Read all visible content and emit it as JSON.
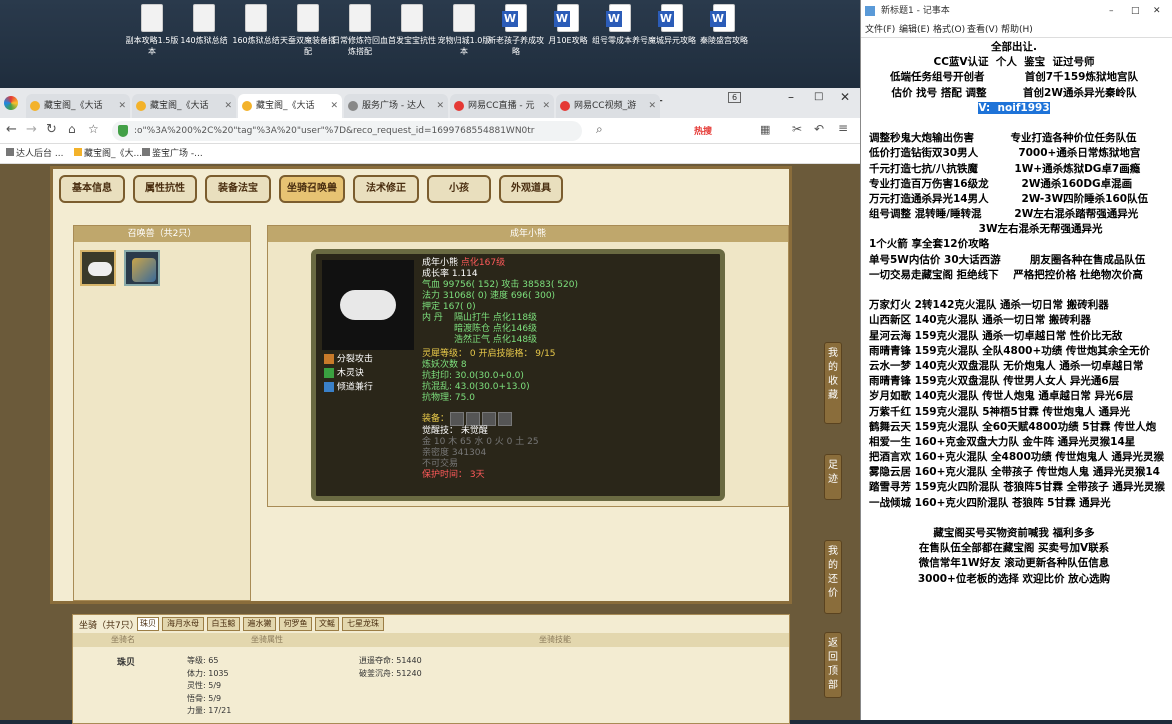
{
  "desktop": {
    "icons": [
      {
        "label": "副本攻略1.5版本",
        "type": "doc"
      },
      {
        "label": "140炼狱总结",
        "type": "doc"
      },
      {
        "label": "160炼狱总结",
        "type": "doc"
      },
      {
        "label": "天蚕双魔装备搭配",
        "type": "doc"
      },
      {
        "label": "日常修炼符回血炼搭配",
        "type": "doc"
      },
      {
        "label": "首发宝宝抗性",
        "type": "doc"
      },
      {
        "label": "宠物归城1.0版本",
        "type": "doc"
      },
      {
        "label": "新老孩子养成攻略",
        "type": "word"
      },
      {
        "label": "月10E攻略",
        "type": "word"
      },
      {
        "label": "组号零成本养号",
        "type": "word"
      },
      {
        "label": "魔城异元攻略",
        "type": "word"
      },
      {
        "label": "秦陵盛宫攻略",
        "type": "word"
      }
    ]
  },
  "browser": {
    "tabs": [
      {
        "label": "藏宝阁_《大话"
      },
      {
        "label": "藏宝阁_《大话"
      },
      {
        "label": "藏宝阁_《大话",
        "active": true
      },
      {
        "label": "服务广场 - 达人"
      },
      {
        "label": "网易CC直播 - 元"
      },
      {
        "label": "网易CC视频_游"
      }
    ],
    "tab_counter": "6",
    "address": ":o\"%3A%200%2C%20\"tag\"%3A%20\"user\"%7D&reco_request_id=1699768554881WN0tr",
    "hot_label": "热搜",
    "bookmarks": [
      "达人后台 ...",
      "藏宝阁_《大...",
      "鉴宝广场 -..."
    ]
  },
  "game": {
    "tabs": [
      "基本信息",
      "属性抗性",
      "装备法宝",
      "坐骑召唤兽",
      "法术修正",
      "小孩",
      "外观道具"
    ],
    "active_tab": "坐骑召唤兽",
    "summon_header": "召唤兽（共2只）",
    "detail_header": "成年小熊",
    "pet": {
      "name": "成年小熊",
      "level_tag": "点化167级",
      "growth": "成长率 1.114",
      "hp": "气血 99756( 152) 攻击 38583( 520)",
      "mp": "法力 31068( 0) 速度 696( 300)",
      "fixed": "押定 167( 0)",
      "neidan_label": "内  丹",
      "neidan": [
        "隔山打牛 点化118级",
        "暗渡陈仓 点化146级",
        "浩然正气 点化148级"
      ],
      "skills": [
        "分裂攻击",
        "木灵诀",
        "倾道兼行"
      ],
      "lingxi": "灵犀等级：  0 开启技能格：  9/15",
      "refine": "炼妖次数 8",
      "resist": [
        "抗封印: 30.0(30.0+0.0)",
        "抗混乱: 43.0(30.0+13.0)",
        "抗物理: 75.0"
      ],
      "equip_label": "装备：",
      "awaken": "觉醒技：  未觉醒",
      "elements": "金 10 木 65 水 0 火 0 土 25",
      "intimacy": "亲密度 341304",
      "untradeable": "不可交易",
      "protect": "保护时间：  3天"
    },
    "side_buttons": [
      "我的收藏",
      "足迹",
      "我的还价",
      "返回顶部"
    ],
    "mounts": {
      "header": "坐骑（共7只）",
      "tabs": [
        "珠贝",
        "海月水母",
        "白玉鲸",
        "遍水獭",
        "何罗鱼",
        "文鳐",
        "七星龙珠"
      ],
      "col_mount": "坐骑名",
      "col_attr": "坐骑属性",
      "col_skill": "坐骑技能",
      "name": "珠贝",
      "attrs": [
        "等级: 65",
        "体力: 1035",
        "灵性: 5/9",
        "悟骨: 5/9",
        "力量: 17/21"
      ],
      "skills": [
        "逍遥夺命: 51440",
        "破釜沉舟: 51240"
      ]
    }
  },
  "notepad": {
    "title": "新标题1 - 记事本",
    "menu": [
      "文件(F)",
      "编辑(E)",
      "格式(O)",
      "查看(V)",
      "帮助(H)"
    ],
    "lines": [
      "全部出让.",
      "CC蓝V认证  个人  鉴宝  证过号师",
      "低端任务组号开创者           首创7千159炼狱地宫队",
      "估价 找号 搭配 调整          首创2W通杀异光秦岭队",
      "V:  noif1993",
      "",
      "调整秒鬼大炮输出伤害          专业打造各种价位任务队伍",
      "低价打造钻街双30男人           7000+通杀日常炼狱地宫",
      "千元打造七抗/八抗铁魔          1W+通杀炼狱DG卓7画瘾",
      "专业打造百万伤害16级龙         2W通杀160DG卓混画",
      "万元打造通杀异光14男人         2W-3W四阶睡杀160队伍",
      "组号调整 混转睡/睡转混         2W左右混杀踏帮强通异光",
      "                              3W左右混杀无帮强通异光",
      "1个火箭 享全套12价攻略",
      "单号5W内估价 30大话西游        朋友圈各种在售成品队伍",
      "一切交易走藏宝阁 拒绝线下    严格把控价格 杜绝物次价高",
      "",
      "万家灯火 2转142克火混队 通杀一切日常 搬砖利器",
      "山西新区 140克火混队 通杀一切日常 搬砖利器",
      "星河云海 159克火混队 通杀一切卓越日常 性价比无敌",
      "雨晴青锋 159克火混队 全队4800+功绩 传世炮其余全无价",
      "云水一梦 140克火双盘混队 无价炮鬼人 通杀一切卓越日常",
      "雨晴青锋 159克火双盘混队 传世男人女人 异光通6层",
      "岁月如歌 140克火混队 传世人炮鬼 通卓越日常 异光6层",
      "万紫千红 159克火混队 5神梧5甘霖 传世炮鬼人 通异光",
      "鹤舞云天 159克火混队 全60天赋4800功绩 5甘霖 传世人炮",
      "相爱一生 160+克金双盘大力队 金牛阵 通异光灵猴14星",
      "把酒言欢 160+克火混队 全4800功绩 传世炮鬼人 通异光灵猴",
      "雾隐云居 160+克火混队 全带孩子 传世炮人鬼 通异光灵猴14",
      "踏雪寻芳 159克火四阶混队 苍狼阵5甘霖 全带孩子 通异光灵猴",
      "一战倾城 160+克火四阶混队 苍狼阵 5甘霖 通异光",
      "",
      "藏宝阁买号买物资前喊我 福利多多",
      "在售队伍全部都在藏宝阁 买卖号加V联系",
      "微信常年1W好友 滚动更新各种队伍信息",
      "3000+位老板的选择 欢迎比价 放心选购"
    ]
  }
}
